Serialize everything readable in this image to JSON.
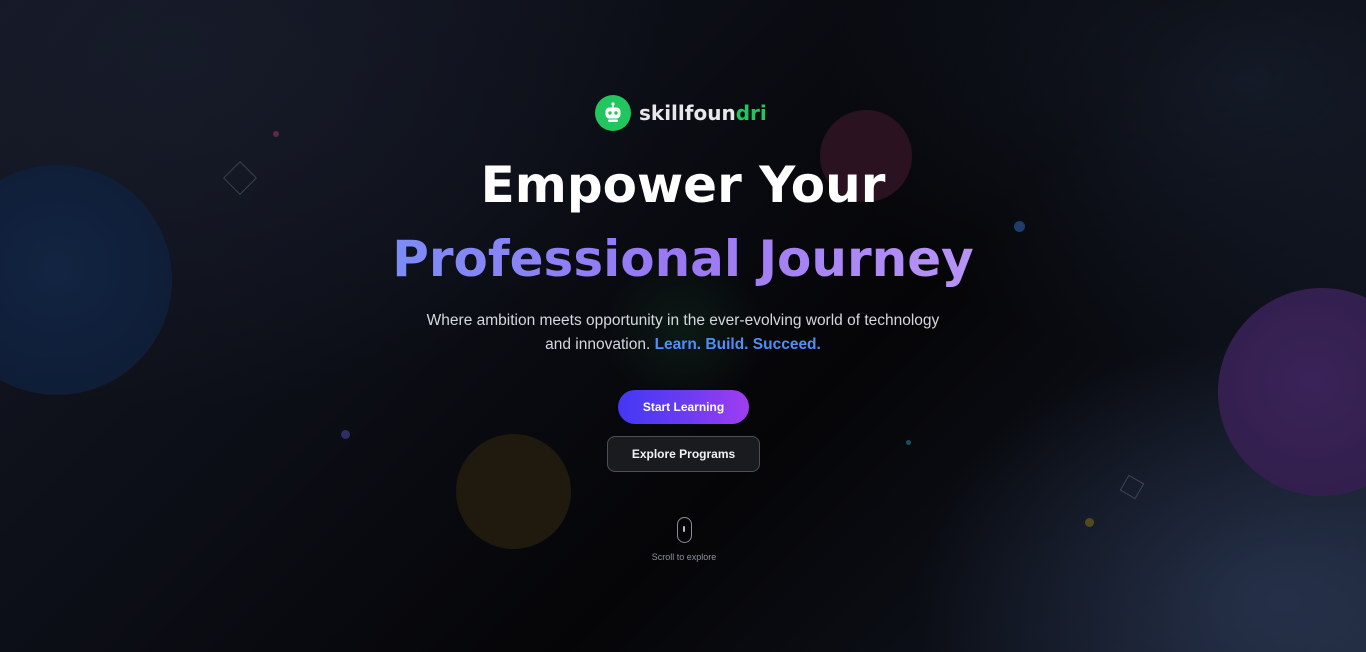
{
  "brand": {
    "name_main": "skillfoun",
    "name_accent": "dri",
    "logo_icon": "robot-icon",
    "accent_color": "#22c55e"
  },
  "hero": {
    "headline_line1": "Empower Your",
    "headline_line2": "Professional Journey",
    "subtitle_line1": "Where ambition meets opportunity in the ever-evolving world of technology",
    "subtitle_line2": "and innovation.",
    "subtitle_highlight": "Learn. Build. Succeed."
  },
  "actions": {
    "primary_label": "Start Learning",
    "secondary_label": "Explore Programs"
  },
  "scroll": {
    "label": "Scroll to explore",
    "icon": "mouse-icon"
  },
  "colors": {
    "highlight": "#4f8ff7",
    "primary_gradient_start": "#4338f5",
    "primary_gradient_end": "#a13df0",
    "headline_gradient_start": "#7c8cf6",
    "headline_gradient_end": "#b894f7"
  }
}
